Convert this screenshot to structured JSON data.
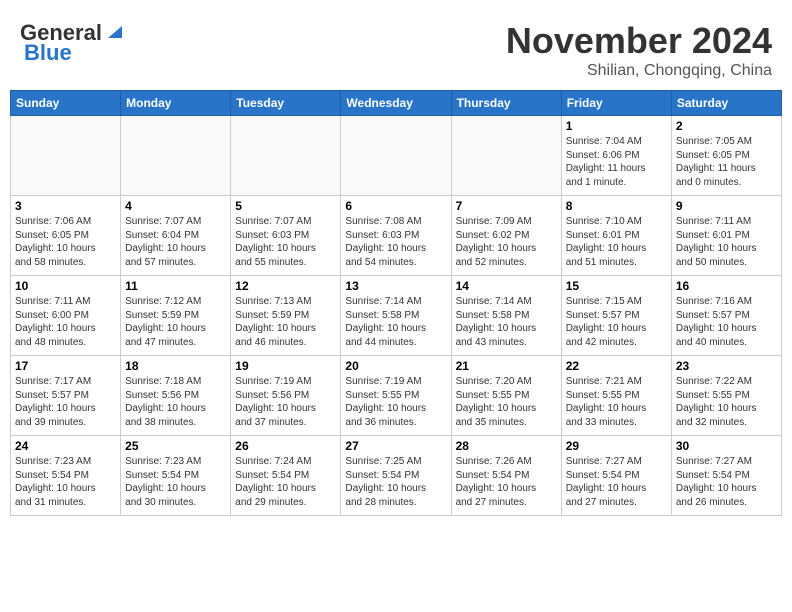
{
  "header": {
    "logo_general": "General",
    "logo_blue": "Blue",
    "month_year": "November 2024",
    "location": "Shilian, Chongqing, China"
  },
  "weekdays": [
    "Sunday",
    "Monday",
    "Tuesday",
    "Wednesday",
    "Thursday",
    "Friday",
    "Saturday"
  ],
  "weeks": [
    [
      {
        "day": "",
        "info": ""
      },
      {
        "day": "",
        "info": ""
      },
      {
        "day": "",
        "info": ""
      },
      {
        "day": "",
        "info": ""
      },
      {
        "day": "",
        "info": ""
      },
      {
        "day": "1",
        "info": "Sunrise: 7:04 AM\nSunset: 6:06 PM\nDaylight: 11 hours\nand 1 minute."
      },
      {
        "day": "2",
        "info": "Sunrise: 7:05 AM\nSunset: 6:05 PM\nDaylight: 11 hours\nand 0 minutes."
      }
    ],
    [
      {
        "day": "3",
        "info": "Sunrise: 7:06 AM\nSunset: 6:05 PM\nDaylight: 10 hours\nand 58 minutes."
      },
      {
        "day": "4",
        "info": "Sunrise: 7:07 AM\nSunset: 6:04 PM\nDaylight: 10 hours\nand 57 minutes."
      },
      {
        "day": "5",
        "info": "Sunrise: 7:07 AM\nSunset: 6:03 PM\nDaylight: 10 hours\nand 55 minutes."
      },
      {
        "day": "6",
        "info": "Sunrise: 7:08 AM\nSunset: 6:03 PM\nDaylight: 10 hours\nand 54 minutes."
      },
      {
        "day": "7",
        "info": "Sunrise: 7:09 AM\nSunset: 6:02 PM\nDaylight: 10 hours\nand 52 minutes."
      },
      {
        "day": "8",
        "info": "Sunrise: 7:10 AM\nSunset: 6:01 PM\nDaylight: 10 hours\nand 51 minutes."
      },
      {
        "day": "9",
        "info": "Sunrise: 7:11 AM\nSunset: 6:01 PM\nDaylight: 10 hours\nand 50 minutes."
      }
    ],
    [
      {
        "day": "10",
        "info": "Sunrise: 7:11 AM\nSunset: 6:00 PM\nDaylight: 10 hours\nand 48 minutes."
      },
      {
        "day": "11",
        "info": "Sunrise: 7:12 AM\nSunset: 5:59 PM\nDaylight: 10 hours\nand 47 minutes."
      },
      {
        "day": "12",
        "info": "Sunrise: 7:13 AM\nSunset: 5:59 PM\nDaylight: 10 hours\nand 46 minutes."
      },
      {
        "day": "13",
        "info": "Sunrise: 7:14 AM\nSunset: 5:58 PM\nDaylight: 10 hours\nand 44 minutes."
      },
      {
        "day": "14",
        "info": "Sunrise: 7:14 AM\nSunset: 5:58 PM\nDaylight: 10 hours\nand 43 minutes."
      },
      {
        "day": "15",
        "info": "Sunrise: 7:15 AM\nSunset: 5:57 PM\nDaylight: 10 hours\nand 42 minutes."
      },
      {
        "day": "16",
        "info": "Sunrise: 7:16 AM\nSunset: 5:57 PM\nDaylight: 10 hours\nand 40 minutes."
      }
    ],
    [
      {
        "day": "17",
        "info": "Sunrise: 7:17 AM\nSunset: 5:57 PM\nDaylight: 10 hours\nand 39 minutes."
      },
      {
        "day": "18",
        "info": "Sunrise: 7:18 AM\nSunset: 5:56 PM\nDaylight: 10 hours\nand 38 minutes."
      },
      {
        "day": "19",
        "info": "Sunrise: 7:19 AM\nSunset: 5:56 PM\nDaylight: 10 hours\nand 37 minutes."
      },
      {
        "day": "20",
        "info": "Sunrise: 7:19 AM\nSunset: 5:55 PM\nDaylight: 10 hours\nand 36 minutes."
      },
      {
        "day": "21",
        "info": "Sunrise: 7:20 AM\nSunset: 5:55 PM\nDaylight: 10 hours\nand 35 minutes."
      },
      {
        "day": "22",
        "info": "Sunrise: 7:21 AM\nSunset: 5:55 PM\nDaylight: 10 hours\nand 33 minutes."
      },
      {
        "day": "23",
        "info": "Sunrise: 7:22 AM\nSunset: 5:55 PM\nDaylight: 10 hours\nand 32 minutes."
      }
    ],
    [
      {
        "day": "24",
        "info": "Sunrise: 7:23 AM\nSunset: 5:54 PM\nDaylight: 10 hours\nand 31 minutes."
      },
      {
        "day": "25",
        "info": "Sunrise: 7:23 AM\nSunset: 5:54 PM\nDaylight: 10 hours\nand 30 minutes."
      },
      {
        "day": "26",
        "info": "Sunrise: 7:24 AM\nSunset: 5:54 PM\nDaylight: 10 hours\nand 29 minutes."
      },
      {
        "day": "27",
        "info": "Sunrise: 7:25 AM\nSunset: 5:54 PM\nDaylight: 10 hours\nand 28 minutes."
      },
      {
        "day": "28",
        "info": "Sunrise: 7:26 AM\nSunset: 5:54 PM\nDaylight: 10 hours\nand 27 minutes."
      },
      {
        "day": "29",
        "info": "Sunrise: 7:27 AM\nSunset: 5:54 PM\nDaylight: 10 hours\nand 27 minutes."
      },
      {
        "day": "30",
        "info": "Sunrise: 7:27 AM\nSunset: 5:54 PM\nDaylight: 10 hours\nand 26 minutes."
      }
    ]
  ]
}
